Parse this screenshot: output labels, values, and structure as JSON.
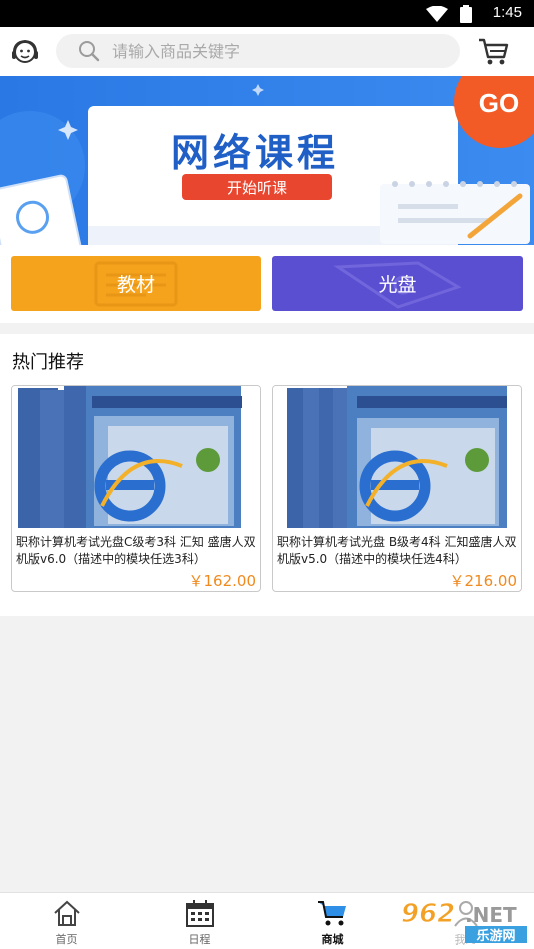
{
  "status": {
    "time": "1:45"
  },
  "search": {
    "placeholder": "请输入商品关键字"
  },
  "banner": {
    "title": "网络课程",
    "button": "开始听课",
    "go": "GO"
  },
  "categories": [
    {
      "label": "教材"
    },
    {
      "label": "光盘"
    }
  ],
  "hot": {
    "title": "热门推荐",
    "products": [
      {
        "name": "职称计算机考试光盘C级考3科 汇知 盛唐人双机版v6.0（描述中的模块任选3科）",
        "price": "￥162.00"
      },
      {
        "name": "职称计算机考试光盘 B级考4科 汇知盛唐人双机版v5.0（描述中的模块任选4科）",
        "price": "￥216.00"
      }
    ]
  },
  "tabs": [
    {
      "label": "首页",
      "icon": "home-icon"
    },
    {
      "label": "日程",
      "icon": "calendar-icon"
    },
    {
      "label": "商城",
      "icon": "shop-cart-icon",
      "active": true
    },
    {
      "label": "我的",
      "icon": "user-icon"
    }
  ],
  "watermark": {
    "number": "962",
    "suffix": ".NET",
    "text": "乐游网"
  },
  "colors": {
    "orange": "#f5a31d",
    "purple": "#5b4fd1",
    "price": "#f08a1f",
    "banner_bg": "#2f7de8"
  }
}
